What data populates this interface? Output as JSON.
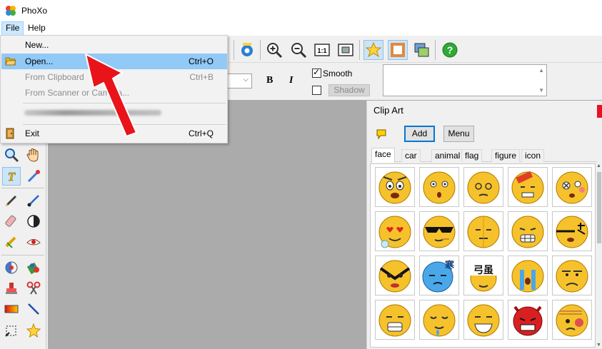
{
  "app": {
    "title": "PhoXo"
  },
  "menubar": {
    "items": [
      "File",
      "Help"
    ]
  },
  "file_menu": {
    "items": [
      {
        "label": "New...",
        "shortcut": "",
        "state": "normal",
        "icon": ""
      },
      {
        "label": "Open...",
        "shortcut": "Ctrl+O",
        "state": "highlighted",
        "icon": "folder-open-icon"
      },
      {
        "label": "From Clipboard",
        "shortcut": "Ctrl+B",
        "state": "disabled",
        "icon": ""
      },
      {
        "label": "From Scanner or Camera...",
        "shortcut": "",
        "state": "disabled",
        "icon": ""
      },
      {
        "label": "Exit",
        "shortcut": "Ctrl+Q",
        "state": "normal",
        "icon": "exit-door-icon"
      }
    ]
  },
  "text_options": {
    "smooth_label": "Smooth",
    "smooth_checked": true,
    "shadow_checked": false,
    "shadow_button": "Shadow"
  },
  "clip_art": {
    "title": "Clip Art",
    "add_button": "Add",
    "menu_button": "Menu",
    "tabs": [
      "face",
      "car",
      "animal",
      "flag",
      "figure",
      "icon"
    ],
    "selected_tab": "face"
  },
  "colors": {
    "accent": "#0078d7",
    "canvas": "#ababab",
    "highlight": "#91c9f7",
    "arrow": "#e8141a"
  }
}
